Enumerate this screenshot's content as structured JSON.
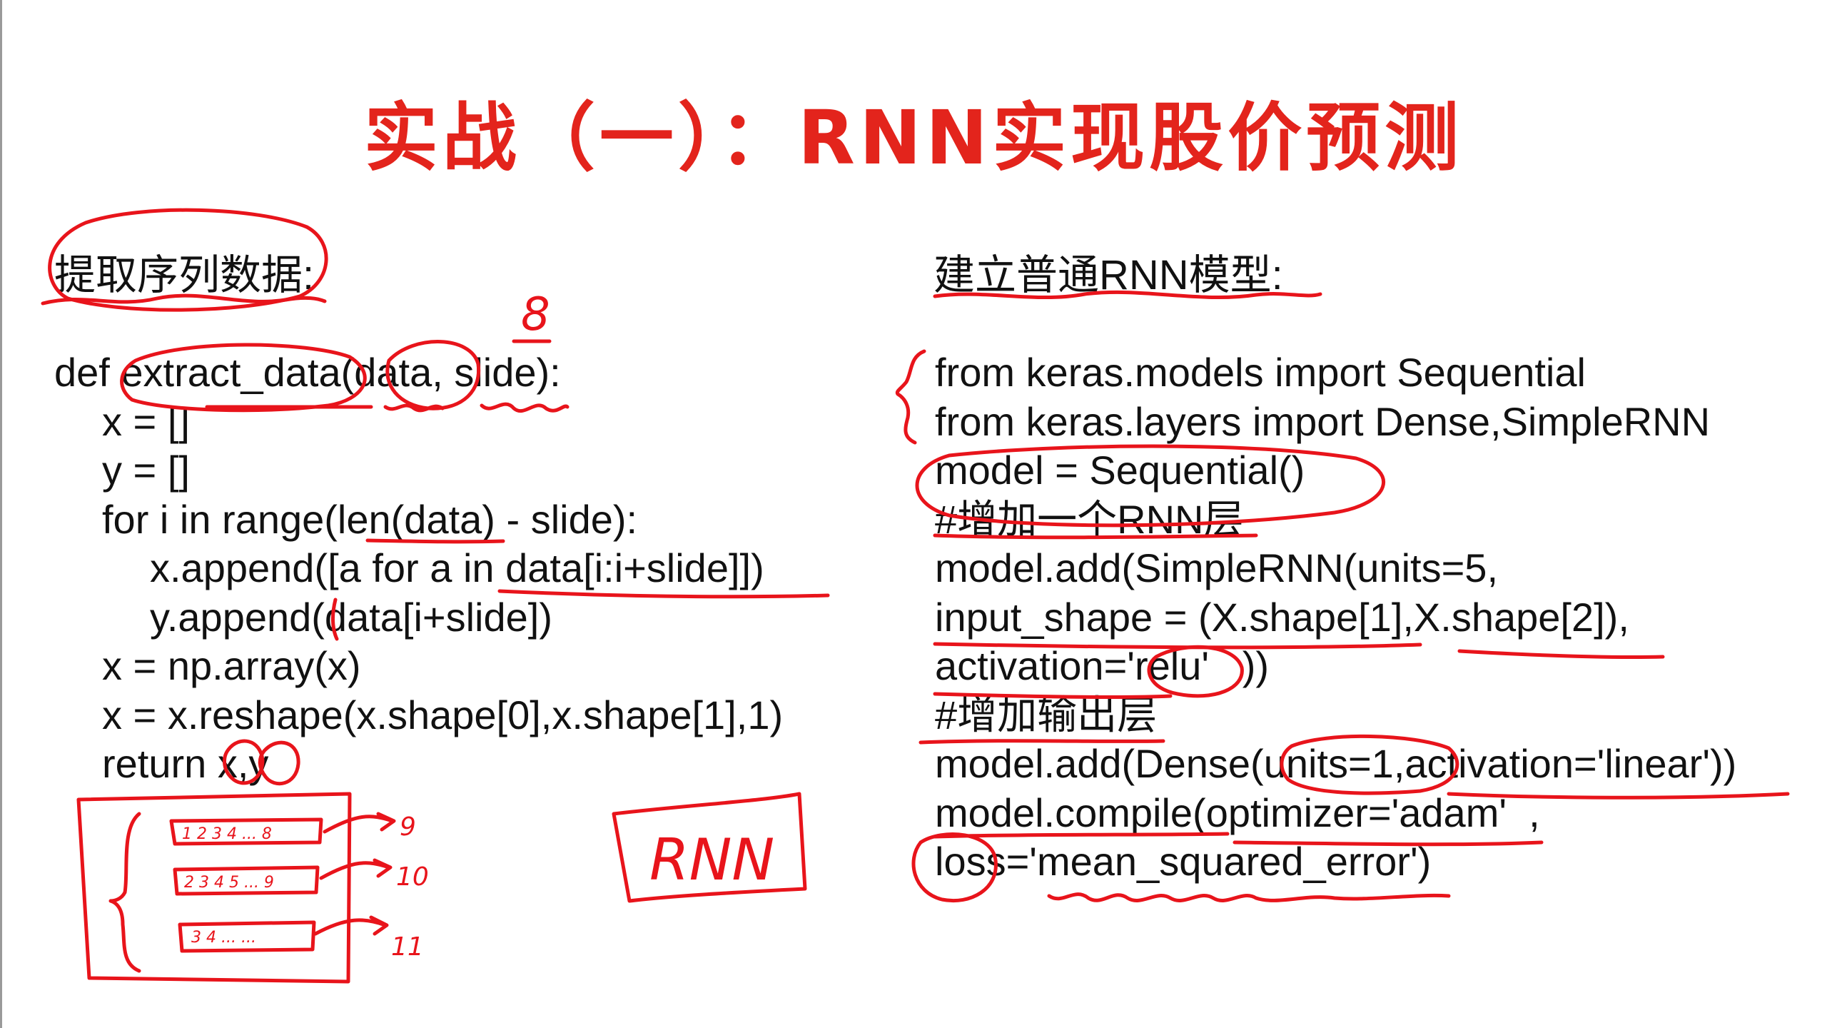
{
  "title": "实战（一）：RNN实现股价预测",
  "left": {
    "heading": "提取序列数据:",
    "code": [
      "def extract_data(data, slide):",
      "x = []",
      "y = []",
      "for i in range(len(data) - slide):",
      "x.append([a for a in data[i:i+slide]])",
      "y.append(data[i+slide])",
      "x = np.array(x)",
      "x = x.reshape(x.shape[0],x.shape[1],1)",
      "return x,y"
    ]
  },
  "right": {
    "heading": "建立普通RNN模型:",
    "code": [
      "from keras.models import Sequential",
      "from keras.layers import Dense,SimpleRNN",
      "model = Sequential()",
      "#增加一个RNN层",
      "model.add(SimpleRNN(units=5,",
      "input_shape = (X.shape[1],X.shape[2]),",
      "activation='relu'   ))",
      "#增加输出层",
      "model.add(Dense(units=1,activation='linear'))",
      "model.compile(optimizer='adam'  ,",
      "loss='mean_squared_error')"
    ]
  },
  "handwriting": {
    "slide_value": "8",
    "seq_row_1": "1 2 3 4 ... 8",
    "seq_row_2": "2 3 4 5 ... 9",
    "seq_row_3": "3 4 ... ...",
    "target_1": "9",
    "target_2": "10",
    "target_3": "11",
    "box_label": "RNN"
  }
}
